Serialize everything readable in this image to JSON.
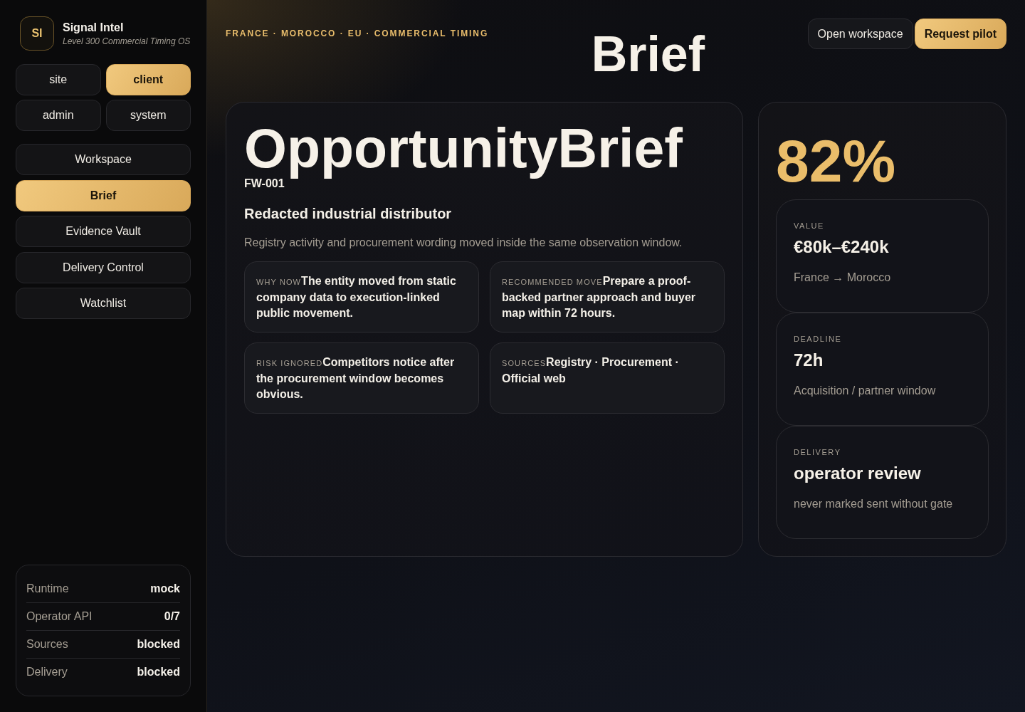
{
  "sidebar": {
    "brand": {
      "logo": "SI",
      "name": "Signal Intel",
      "tagline": "Level 300 Commercial Timing OS"
    },
    "modes": [
      {
        "label": "site",
        "selected": false
      },
      {
        "label": "client",
        "selected": true
      },
      {
        "label": "admin",
        "selected": false
      },
      {
        "label": "system",
        "selected": false
      }
    ],
    "nav": [
      {
        "label": "Workspace",
        "selected": false
      },
      {
        "label": "Brief",
        "selected": true
      },
      {
        "label": "Evidence Vault",
        "selected": false
      },
      {
        "label": "Delivery Control",
        "selected": false
      },
      {
        "label": "Watchlist",
        "selected": false
      }
    ],
    "status": [
      {
        "label": "Runtime",
        "value": "mock"
      },
      {
        "label": "Operator API",
        "value": "0/7"
      },
      {
        "label": "Sources",
        "value": "blocked"
      },
      {
        "label": "Delivery",
        "value": "blocked"
      }
    ]
  },
  "header": {
    "kicker": "FRANCE · MOROCCO · EU · COMMERCIAL TIMING",
    "title": "Brief",
    "actions": [
      {
        "label": "Open workspace",
        "kind": "secondary"
      },
      {
        "label": "Request pilot",
        "kind": "primary"
      }
    ]
  },
  "brief": {
    "title": "OpportunityBrief",
    "code": "FW-001",
    "entity": "Redacted industrial distributor",
    "summary": "Registry activity and procurement wording moved inside the same observation window.",
    "cards": [
      {
        "label": "WHY NOW",
        "text": "The entity moved from static company data to execution-linked public movement."
      },
      {
        "label": "RECOMMENDED MOVE",
        "text": "Prepare a proof-backed partner approach and buyer map within 72 hours."
      },
      {
        "label": "RISK IGNORED",
        "text": "Competitors notice after the procurement window becomes obvious."
      },
      {
        "label": "SOURCES",
        "text": "Registry · Procurement · Official web"
      }
    ]
  },
  "metrics": {
    "score": "82%",
    "stats": [
      {
        "label": "VALUE",
        "value": "€80k–€240k",
        "note": "France → Morocco"
      },
      {
        "label": "DEADLINE",
        "value": "72h",
        "note": "Acquisition / partner window"
      },
      {
        "label": "DELIVERY",
        "value": "operator review",
        "note": "never marked sent without gate"
      }
    ]
  }
}
